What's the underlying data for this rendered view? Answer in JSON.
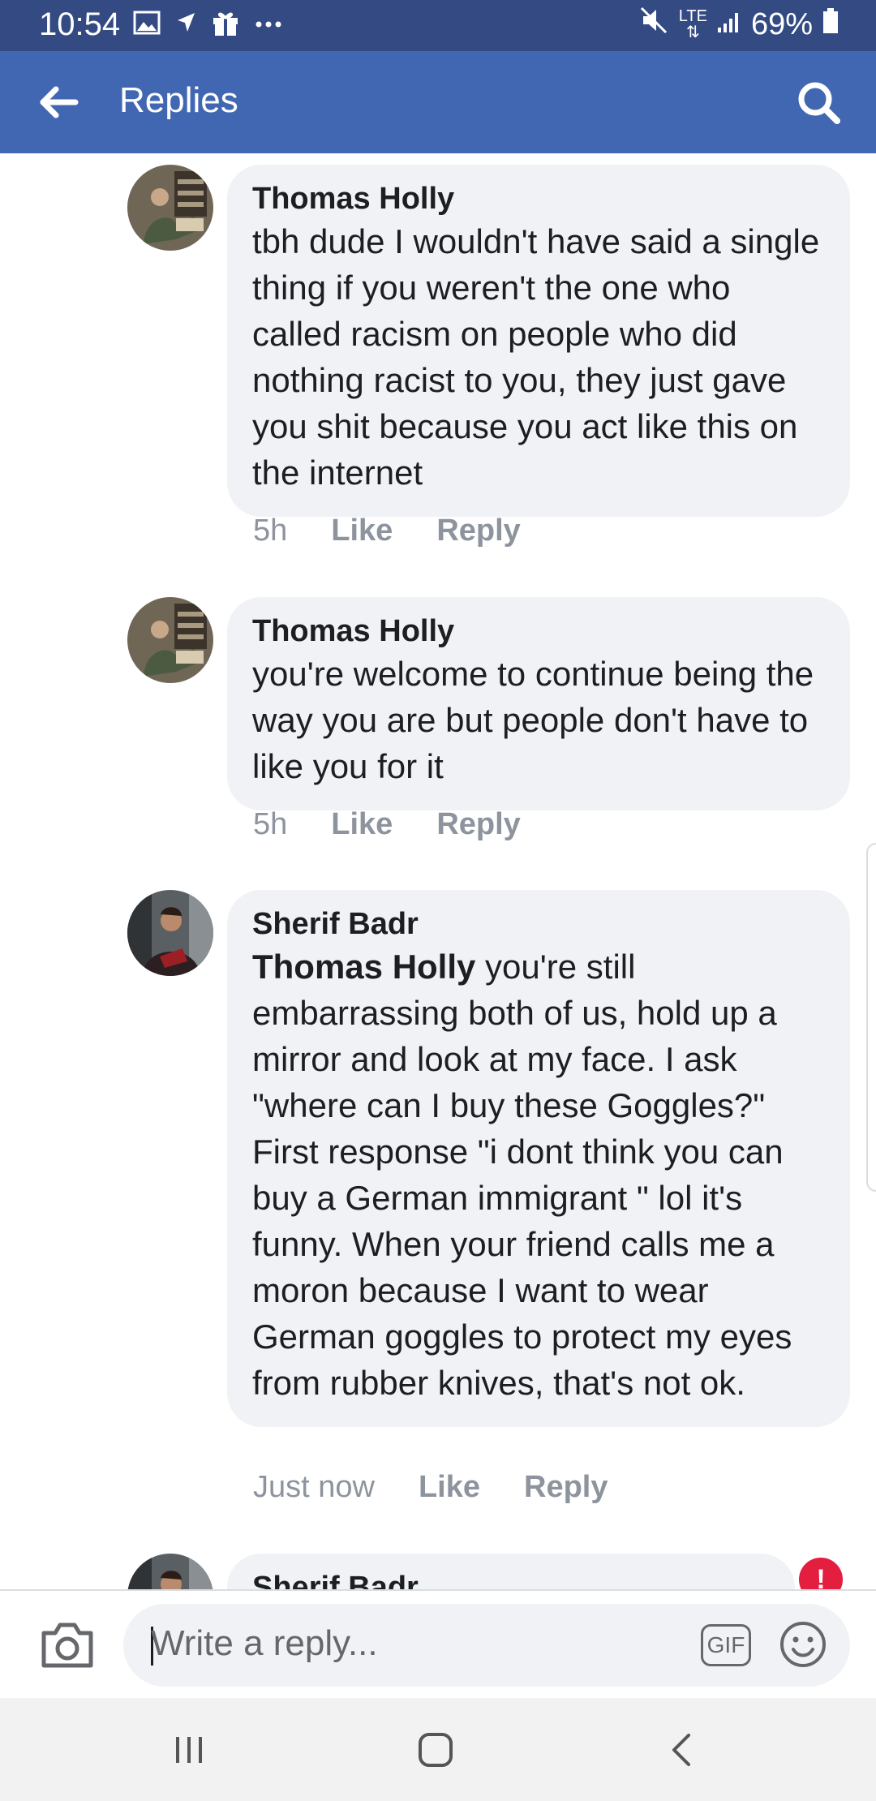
{
  "status_bar": {
    "time": "10:54",
    "network": "LTE",
    "battery": "69%",
    "icons": [
      "image-icon",
      "navigation-icon",
      "gift-icon",
      "more-icon",
      "mute-icon",
      "signal-icon",
      "battery-icon"
    ]
  },
  "app_bar": {
    "title": "Replies",
    "back_icon": "arrow-left-icon",
    "search_icon": "search-icon",
    "color": "#4267b2"
  },
  "comments": [
    {
      "author": "Thomas Holly",
      "mention": "",
      "text": "tbh dude I wouldn't have said a single thing if you weren't the one who called racism on people who did nothing racist to you, they just gave you shit because you act like this on the internet",
      "time": "5h",
      "like_label": "Like",
      "reply_label": "Reply"
    },
    {
      "author": "Thomas Holly",
      "mention": "",
      "text": "you're welcome to continue being the way you are but people don't have to like you for it",
      "time": "5h",
      "like_label": "Like",
      "reply_label": "Reply"
    },
    {
      "author": "Sherif Badr",
      "mention": "Thomas Holly",
      "text": " you're still embarrassing both of us, hold up a mirror and look at my face. I ask \"where can I buy these Goggles?\" First response \"i dont think you can buy a German immigrant \" lol it's funny. When your friend calls me a moron because I want to wear German goggles to protect my eyes from rubber knives, that's not ok.",
      "time": "Just now",
      "like_label": "Like",
      "reply_label": "Reply"
    },
    {
      "author": "Sherif Badr",
      "status": "error"
    }
  ],
  "composer": {
    "placeholder": "Write a reply...",
    "gif_label": "GIF",
    "camera_icon": "camera-icon",
    "emoji_icon": "emoji-icon"
  },
  "nav_bar": {
    "icons": [
      "recent-apps-icon",
      "home-icon",
      "back-icon"
    ]
  }
}
